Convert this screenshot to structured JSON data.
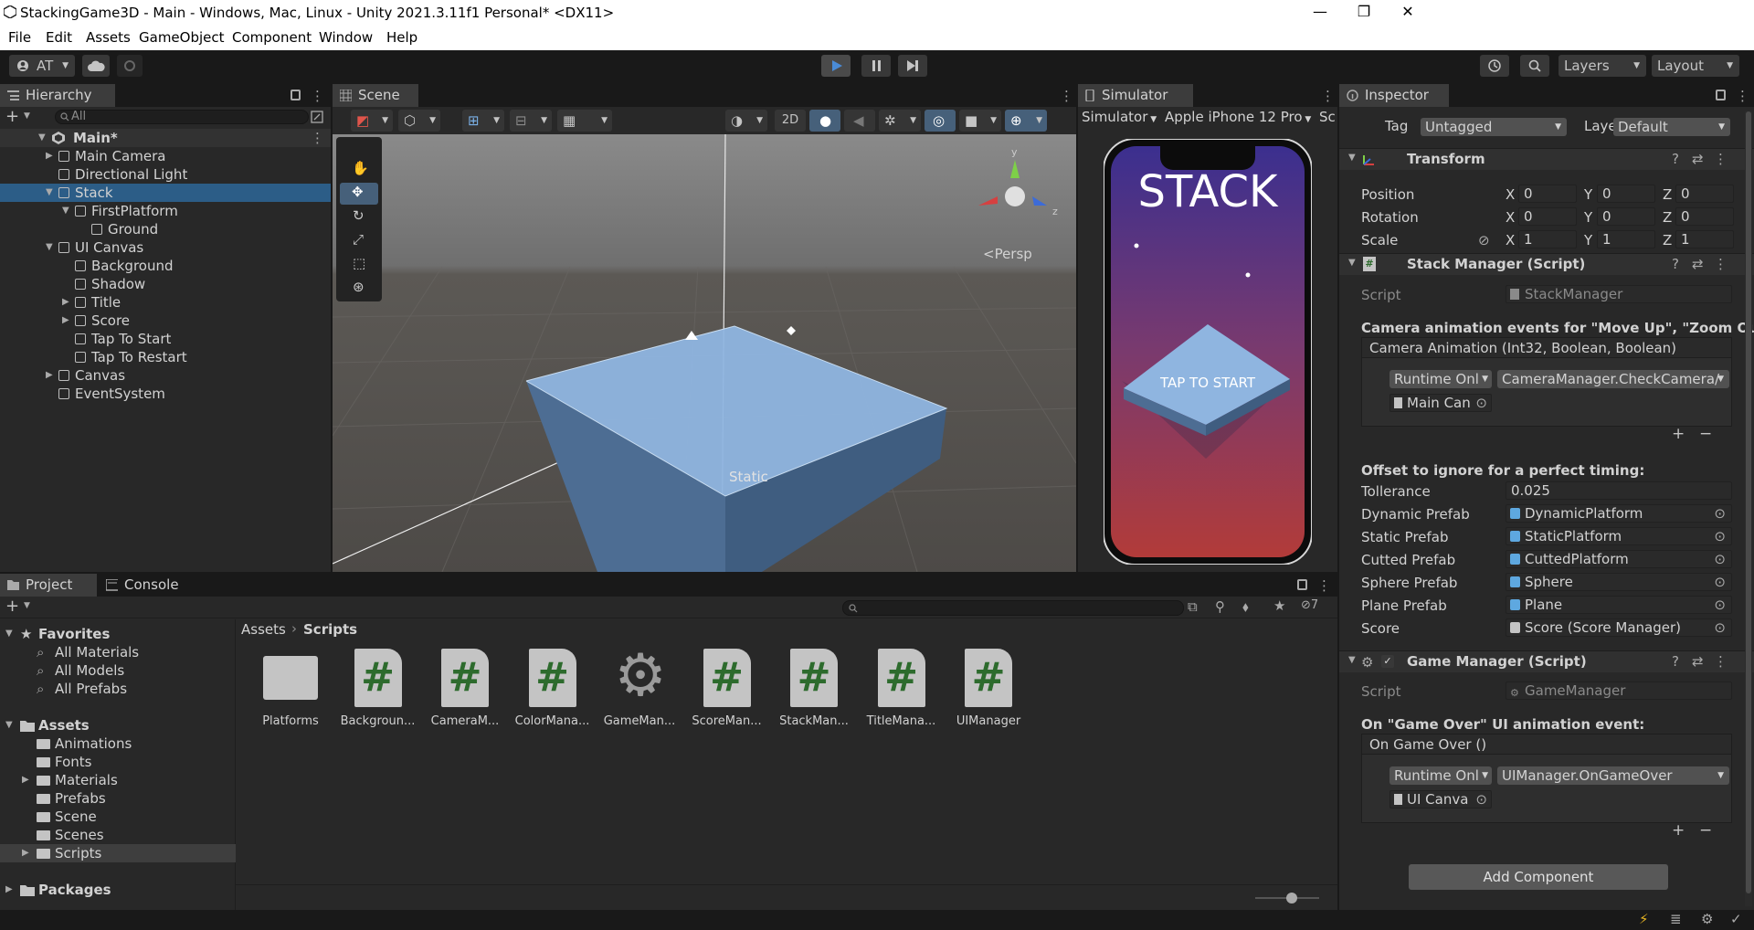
{
  "window": {
    "title": "StackingGame3D - Main - Windows, Mac, Linux - Unity 2021.3.11f1 Personal* <DX11>",
    "controls": {
      "minimize": "—",
      "maximize": "❐",
      "close": "✕"
    }
  },
  "menu": [
    "File",
    "Edit",
    "Assets",
    "GameObject",
    "Component",
    "Window",
    "Help"
  ],
  "toolbar": {
    "account": "AT",
    "layers": "Layers",
    "layout": "Layout"
  },
  "hierarchy": {
    "tab": "Hierarchy",
    "search_placeholder": "All",
    "scene": "Main*",
    "items": [
      {
        "label": "Main Camera"
      },
      {
        "label": "Directional Light"
      },
      {
        "label": "Stack"
      },
      {
        "label": "FirstPlatform"
      },
      {
        "label": "Ground"
      },
      {
        "label": "UI Canvas"
      },
      {
        "label": "Background"
      },
      {
        "label": "Shadow"
      },
      {
        "label": "Title"
      },
      {
        "label": "Score"
      },
      {
        "label": "Tap To Start"
      },
      {
        "label": "Tap To Restart"
      },
      {
        "label": "Canvas"
      },
      {
        "label": "EventSystem"
      }
    ]
  },
  "scene": {
    "tab": "Scene",
    "mode_2d": "2D",
    "persp": "<Persp",
    "static_label": "Static"
  },
  "simulator": {
    "tab": "Simulator",
    "mode": "Simulator",
    "device": "Apple iPhone 12 Pro",
    "extra": "Sc",
    "game_title": "STACK",
    "tap_text": "TAP TO START"
  },
  "inspector": {
    "tab": "Inspector",
    "tag_label": "Tag",
    "tag_value": "Untagged",
    "layer_label": "Layer",
    "layer_value": "Default",
    "transform": {
      "title": "Transform",
      "position_label": "Position",
      "rotation_label": "Rotation",
      "scale_label": "Scale",
      "position": [
        "0",
        "0",
        "0"
      ],
      "rotation": [
        "0",
        "0",
        "0"
      ],
      "scale": [
        "1",
        "1",
        "1"
      ],
      "axis": [
        "X",
        "Y",
        "Z"
      ]
    },
    "stack_manager": {
      "title": "Stack Manager (Script)",
      "script_label": "Script",
      "script_value": "StackManager",
      "camera_header": "Camera animation events for \"Move Up\", \"Zoom Out\" ar",
      "event_title": "Camera Animation (Int32, Boolean, Boolean)",
      "runtime": "Runtime Onl",
      "function": "CameraManager.CheckCamera/",
      "target": "Main Can",
      "plus": "+",
      "minus": "−",
      "offset_header": "Offset to ignore for a perfect timing:",
      "fields": [
        {
          "label": "Tollerance",
          "value": "0.025"
        },
        {
          "label": "Dynamic Prefab",
          "value": "DynamicPlatform"
        },
        {
          "label": "Static Prefab",
          "value": "StaticPlatform"
        },
        {
          "label": "Cutted Prefab",
          "value": "CuttedPlatform"
        },
        {
          "label": "Sphere Prefab",
          "value": "Sphere"
        },
        {
          "label": "Plane Prefab",
          "value": "Plane"
        },
        {
          "label": "Score",
          "value": "Score (Score Manager)"
        }
      ]
    },
    "game_manager": {
      "title": "Game Manager (Script)",
      "script_label": "Script",
      "script_value": "GameManager",
      "event_header": "On \"Game Over\" UI animation event:",
      "event_title": "On Game Over ()",
      "runtime": "Runtime Onl",
      "function": "UIManager.OnGameOver",
      "target": "UI Canva",
      "plus": "+",
      "minus": "−"
    },
    "add_component": "Add Component"
  },
  "project": {
    "tab_project": "Project",
    "tab_console": "Console",
    "hidden_count": "7",
    "favorites": "Favorites",
    "fav_items": [
      "All Materials",
      "All Models",
      "All Prefabs"
    ],
    "assets": "Assets",
    "asset_folders": [
      "Animations",
      "Fonts",
      "Materials",
      "Prefabs",
      "Scene",
      "Scenes",
      "Scripts"
    ],
    "packages": "Packages",
    "breadcrumb": [
      "Assets",
      "Scripts"
    ],
    "files": [
      {
        "name": "Platforms",
        "kind": "folder"
      },
      {
        "name": "Backgroun...",
        "kind": "script"
      },
      {
        "name": "CameraM...",
        "kind": "script"
      },
      {
        "name": "ColorMana...",
        "kind": "script"
      },
      {
        "name": "GameMan...",
        "kind": "gear"
      },
      {
        "name": "ScoreMan...",
        "kind": "script"
      },
      {
        "name": "StackMan...",
        "kind": "script"
      },
      {
        "name": "TitleMana...",
        "kind": "script"
      },
      {
        "name": "UIManager",
        "kind": "script"
      }
    ]
  },
  "colors": {
    "accent": "#2c5d87",
    "play_active": "#4a8bd6",
    "platform": "#7ea6d6",
    "sim_top": "#3b2f8f",
    "sim_bottom": "#b23b39"
  }
}
